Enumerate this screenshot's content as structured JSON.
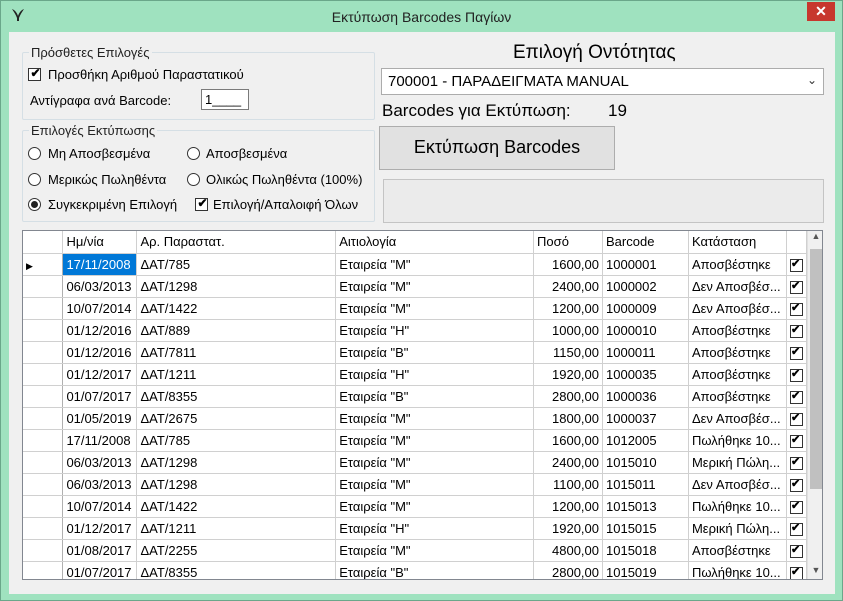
{
  "window": {
    "title": "Εκτύπωση Barcodes Παγίων",
    "close": "✕"
  },
  "extra": {
    "title": "Πρόσθετες Επιλογές",
    "add_doc_label": "Προσθήκη Αριθμού Παραστατικού",
    "add_doc_checked": true,
    "copies_label": "Αντίγραφα ανά Barcode:",
    "copies_value": "1____"
  },
  "print_opts": {
    "title": "Επιλογές Εκτύπωσης",
    "options": [
      {
        "label": "Μη Αποσβεσμένα",
        "checked": false
      },
      {
        "label": "Αποσβεσμένα",
        "checked": false
      },
      {
        "label": "Μερικώς Πωληθέντα",
        "checked": false
      },
      {
        "label": "Ολικώς Πωληθέντα (100%)",
        "checked": false
      },
      {
        "label": "Συγκεκριμένη Επιλογή",
        "checked": true
      }
    ],
    "select_all_label": "Επιλογή/Απαλοιφή Όλων",
    "select_all_checked": true
  },
  "entity": {
    "title": "Επιλογή Οντότητας",
    "value": "700001 - ΠΑΡΑΔΕΙΓΜΑΤΑ MANUAL",
    "count_label": "Barcodes για Εκτύπωση:",
    "count_value": "19",
    "print_button": "Εκτύπωση Barcodes"
  },
  "grid": {
    "columns": [
      "Ημ/νία",
      "Αρ. Παραστατ.",
      "Αιτιολογία",
      "Ποσό",
      "Barcode",
      "Κατάσταση"
    ],
    "rows": [
      [
        "17/11/2008",
        "ΔΑΤ/785",
        "Εταιρεία \"M\"",
        "1600,00",
        "1000001",
        "Αποσβέστηκε"
      ],
      [
        "06/03/2013",
        "ΔΑΤ/1298",
        "Εταιρεία \"M\"",
        "2400,00",
        "1000002",
        "Δεν Αποσβέσ..."
      ],
      [
        "10/07/2014",
        "ΔΑΤ/1422",
        "Εταιρεία \"M\"",
        "1200,00",
        "1000009",
        "Δεν Αποσβέσ..."
      ],
      [
        "01/12/2016",
        "ΔΑΤ/889",
        "Εταιρεία \"H\"",
        "1000,00",
        "1000010",
        "Αποσβέστηκε"
      ],
      [
        "01/12/2016",
        "ΔΑΤ/7811",
        "Εταιρεία \"B\"",
        "1150,00",
        "1000011",
        "Αποσβέστηκε"
      ],
      [
        "01/12/2017",
        "ΔΑΤ/1211",
        "Εταιρεία \"H\"",
        "1920,00",
        "1000035",
        "Αποσβέστηκε"
      ],
      [
        "01/07/2017",
        "ΔΑΤ/8355",
        "Εταιρεία \"B\"",
        "2800,00",
        "1000036",
        "Αποσβέστηκε"
      ],
      [
        "01/05/2019",
        "ΔΑΤ/2675",
        "Εταιρεία \"M\"",
        "1800,00",
        "1000037",
        "Δεν Αποσβέσ..."
      ],
      [
        "17/11/2008",
        "ΔΑΤ/785",
        "Εταιρεία \"M\"",
        "1600,00",
        "1012005",
        "Πωλήθηκε 10..."
      ],
      [
        "06/03/2013",
        "ΔΑΤ/1298",
        "Εταιρεία \"M\"",
        "2400,00",
        "1015010",
        "Μερική Πώλη..."
      ],
      [
        "06/03/2013",
        "ΔΑΤ/1298",
        "Εταιρεία \"M\"",
        "1100,00",
        "1015011",
        "Δεν Αποσβέσ..."
      ],
      [
        "10/07/2014",
        "ΔΑΤ/1422",
        "Εταιρεία \"M\"",
        "1200,00",
        "1015013",
        "Πωλήθηκε 10..."
      ],
      [
        "01/12/2017",
        "ΔΑΤ/1211",
        "Εταιρεία \"H\"",
        "1920,00",
        "1015015",
        "Μερική Πώλη..."
      ],
      [
        "01/08/2017",
        "ΔΑΤ/2255",
        "Εταιρεία \"M\"",
        "4800,00",
        "1015018",
        "Αποσβέστηκε"
      ],
      [
        "01/07/2017",
        "ΔΑΤ/8355",
        "Εταιρεία \"B\"",
        "2800,00",
        "1015019",
        "Πωλήθηκε 10..."
      ]
    ]
  }
}
